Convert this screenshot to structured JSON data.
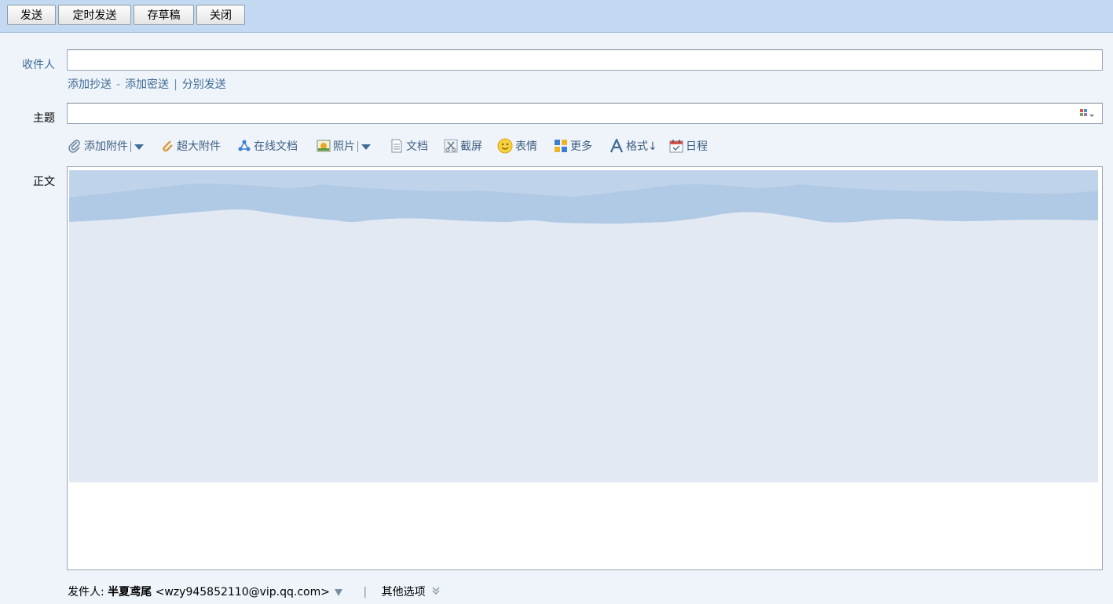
{
  "toolbar_top": {
    "send": "发送",
    "scheduled_send": "定时发送",
    "save_draft": "存草稿",
    "close": "关闭"
  },
  "fields": {
    "to_label": "收件人",
    "to_value": "",
    "add_cc": "添加抄送",
    "add_bcc": "添加密送",
    "separate_send": "分别发送",
    "dash": "-",
    "pipe": "|",
    "subject_label": "主题",
    "subject_value": "",
    "body_label": "正文"
  },
  "compose_toolbar": {
    "add_attachment": "添加附件",
    "large_attachment": "超大附件",
    "online_doc": "在线文档",
    "photo": "照片",
    "document": "文档",
    "screenshot": "截屏",
    "emoji": "表情",
    "more": "更多",
    "format": "格式↓",
    "calendar": "日程"
  },
  "footer": {
    "sender_label": "发件人:",
    "sender_name": "半夏鸢尾",
    "sender_email": "<wzy945852110@vip.qq.com>",
    "pipe": "|",
    "other_options": "其他选项"
  },
  "colors": {
    "topbar": "#c3d9f1",
    "page_bg": "#eff4fb",
    "link": "#3f6b94",
    "stationery": "#e2e9f3"
  }
}
